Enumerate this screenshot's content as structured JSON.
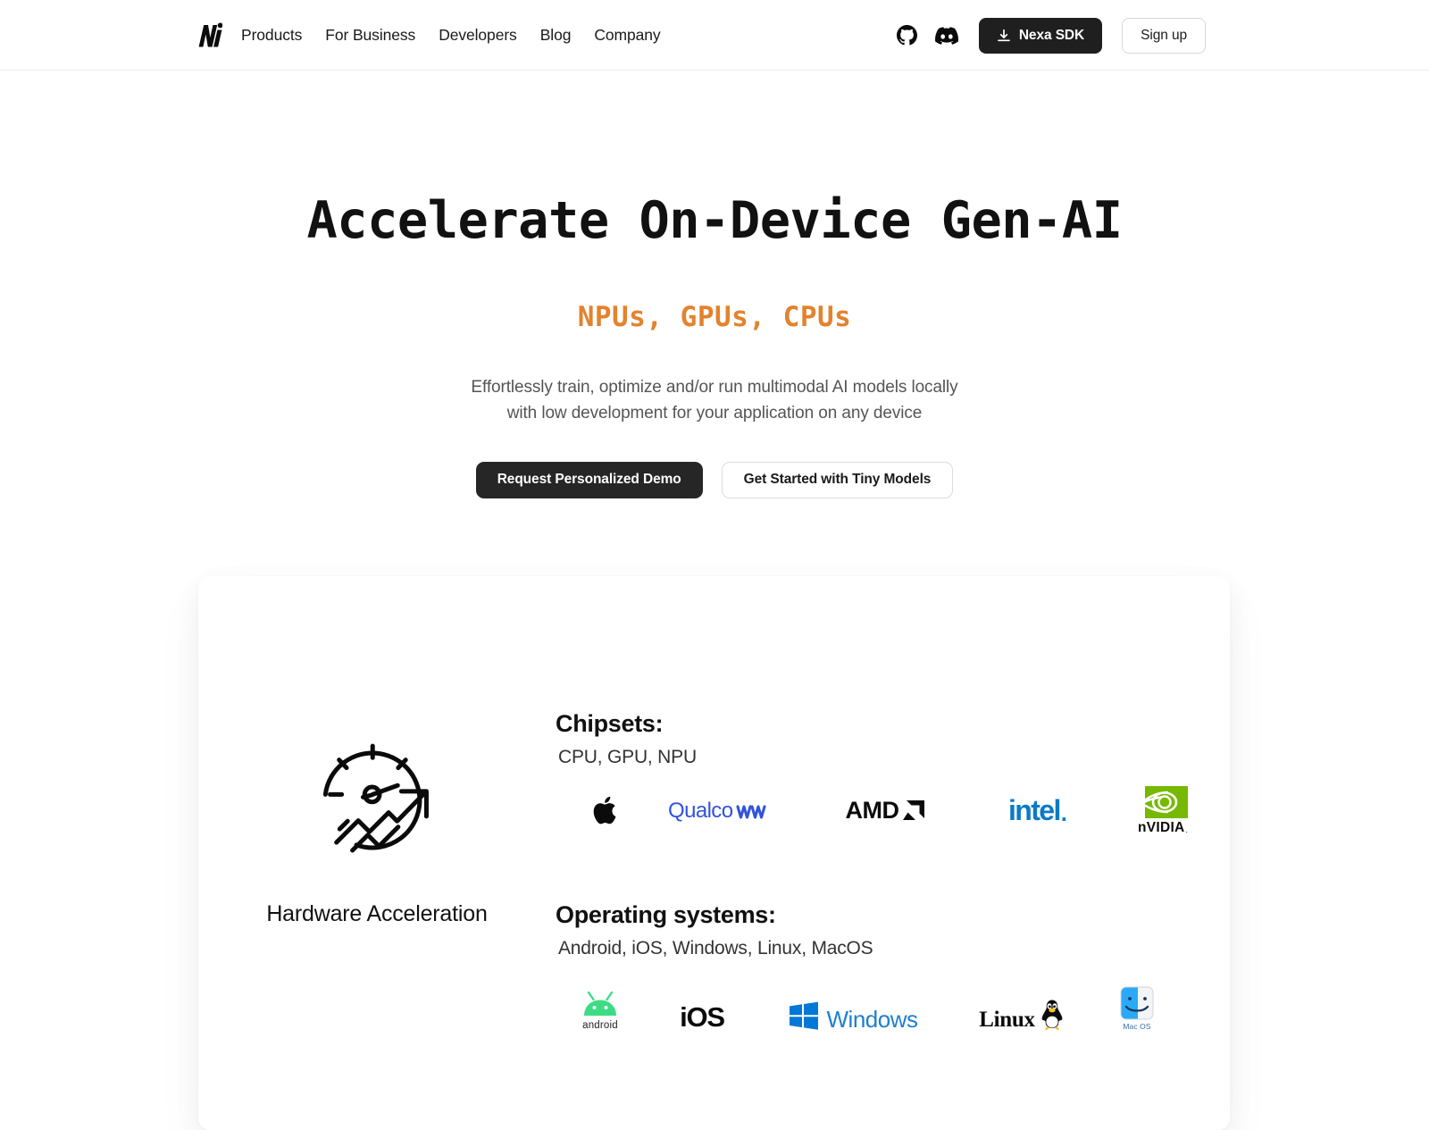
{
  "header": {
    "logo_alt": "Nexa AI logo",
    "nav": [
      {
        "label": "Products"
      },
      {
        "label": "For Business"
      },
      {
        "label": "Developers"
      },
      {
        "label": "Blog"
      },
      {
        "label": "Company"
      }
    ],
    "github_icon": "github-icon",
    "discord_icon": "discord-icon",
    "sdk_button": "Nexa SDK",
    "signup_button": "Sign up"
  },
  "hero": {
    "title": "Accelerate On-Device Gen-AI",
    "subtitle": "NPUs, GPUs, CPUs",
    "description_line1": "Effortlessly train, optimize and/or run multimodal AI models locally",
    "description_line2": "with low development for your application on any device",
    "primary_button": "Request Personalized Demo",
    "secondary_button": "Get Started with Tiny Models"
  },
  "feature_card": {
    "hardware": {
      "icon": "speedometer-growth-icon",
      "label": "Hardware Acceleration"
    },
    "chipsets": {
      "heading": "Chipsets:",
      "subtitle": "CPU, GPU, NPU",
      "logos": [
        {
          "name": "apple-logo",
          "label": "Apple"
        },
        {
          "name": "qualcomm-logo",
          "label": "Qualcomm"
        },
        {
          "name": "amd-logo",
          "label": "AMD"
        },
        {
          "name": "intel-logo",
          "label": "intel"
        },
        {
          "name": "nvidia-logo",
          "label": "nVIDIA"
        }
      ]
    },
    "operating_systems": {
      "heading": "Operating systems:",
      "subtitle": "Android, iOS, Windows, Linux, MacOS",
      "logos": [
        {
          "name": "android-logo",
          "label": "android"
        },
        {
          "name": "ios-logo",
          "label": "iOS"
        },
        {
          "name": "windows-logo",
          "label": "Windows"
        },
        {
          "name": "linux-logo",
          "label": "Linux"
        },
        {
          "name": "macos-logo",
          "label": "Mac OS"
        }
      ]
    }
  },
  "colors": {
    "accent_orange": "#e2832e",
    "dark": "#262626",
    "qualcomm_blue": "#3253dc",
    "intel_blue": "#0b7ac6",
    "nvidia_green": "#76b900",
    "android_green": "#3ddc84",
    "windows_blue": "#1d7fd1",
    "macos_blue": "#28a9f5"
  }
}
